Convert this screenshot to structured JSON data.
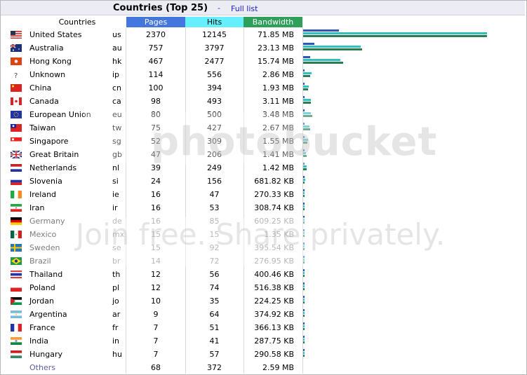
{
  "title": "Countries (Top 25)",
  "separator": "-",
  "full_list_link": "Full list",
  "headers": {
    "countries": "Countries",
    "pages": "Pages",
    "hits": "Hits",
    "bandwidth": "Bandwidth"
  },
  "colors": {
    "pages": "#4477dd",
    "hits": "#66f0ff",
    "bandwidth": "#2ea05a"
  },
  "rows": [
    {
      "flag": "us-flag-icon",
      "name": "United States",
      "code": "us",
      "pages": "2370",
      "hits": "12145",
      "bandwidth": "71.85 MB"
    },
    {
      "flag": "au-flag-icon",
      "name": "Australia",
      "code": "au",
      "pages": "757",
      "hits": "3797",
      "bandwidth": "23.13 MB"
    },
    {
      "flag": "hk-flag-icon",
      "name": "Hong Kong",
      "code": "hk",
      "pages": "467",
      "hits": "2477",
      "bandwidth": "15.74 MB"
    },
    {
      "flag": "unknown-flag-icon",
      "name": "Unknown",
      "code": "ip",
      "pages": "114",
      "hits": "556",
      "bandwidth": "2.86 MB"
    },
    {
      "flag": "cn-flag-icon",
      "name": "China",
      "code": "cn",
      "pages": "100",
      "hits": "394",
      "bandwidth": "1.93 MB"
    },
    {
      "flag": "ca-flag-icon",
      "name": "Canada",
      "code": "ca",
      "pages": "98",
      "hits": "493",
      "bandwidth": "3.11 MB"
    },
    {
      "flag": "eu-flag-icon",
      "name": "European Union",
      "code": "eu",
      "pages": "80",
      "hits": "500",
      "bandwidth": "3.48 MB"
    },
    {
      "flag": "tw-flag-icon",
      "name": "Taiwan",
      "code": "tw",
      "pages": "75",
      "hits": "427",
      "bandwidth": "2.67 MB"
    },
    {
      "flag": "sg-flag-icon",
      "name": "Singapore",
      "code": "sg",
      "pages": "52",
      "hits": "309",
      "bandwidth": "1.55 MB"
    },
    {
      "flag": "gb-flag-icon",
      "name": "Great Britain",
      "code": "gb",
      "pages": "47",
      "hits": "206",
      "bandwidth": "1.41 MB"
    },
    {
      "flag": "nl-flag-icon",
      "name": "Netherlands",
      "code": "nl",
      "pages": "39",
      "hits": "249",
      "bandwidth": "1.42 MB"
    },
    {
      "flag": "si-flag-icon",
      "name": "Slovenia",
      "code": "si",
      "pages": "24",
      "hits": "156",
      "bandwidth": "681.82 KB"
    },
    {
      "flag": "ie-flag-icon",
      "name": "Ireland",
      "code": "ie",
      "pages": "16",
      "hits": "47",
      "bandwidth": "270.33 KB"
    },
    {
      "flag": "ir-flag-icon",
      "name": "Iran",
      "code": "ir",
      "pages": "16",
      "hits": "53",
      "bandwidth": "308.74 KB"
    },
    {
      "flag": "de-flag-icon",
      "name": "Germany",
      "code": "de",
      "pages": "16",
      "hits": "85",
      "bandwidth": "609.25 KB"
    },
    {
      "flag": "mx-flag-icon",
      "name": "Mexico",
      "code": "mx",
      "pages": "15",
      "hits": "15",
      "bandwidth": "1.35 KB"
    },
    {
      "flag": "se-flag-icon",
      "name": "Sweden",
      "code": "se",
      "pages": "15",
      "hits": "92",
      "bandwidth": "395.54 KB"
    },
    {
      "flag": "br-flag-icon",
      "name": "Brazil",
      "code": "br",
      "pages": "14",
      "hits": "72",
      "bandwidth": "276.95 KB"
    },
    {
      "flag": "th-flag-icon",
      "name": "Thailand",
      "code": "th",
      "pages": "12",
      "hits": "56",
      "bandwidth": "400.46 KB"
    },
    {
      "flag": "pl-flag-icon",
      "name": "Poland",
      "code": "pl",
      "pages": "12",
      "hits": "74",
      "bandwidth": "516.38 KB"
    },
    {
      "flag": "jo-flag-icon",
      "name": "Jordan",
      "code": "jo",
      "pages": "10",
      "hits": "35",
      "bandwidth": "224.25 KB"
    },
    {
      "flag": "ar-flag-icon",
      "name": "Argentina",
      "code": "ar",
      "pages": "9",
      "hits": "64",
      "bandwidth": "374.92 KB"
    },
    {
      "flag": "fr-flag-icon",
      "name": "France",
      "code": "fr",
      "pages": "7",
      "hits": "51",
      "bandwidth": "366.13 KB"
    },
    {
      "flag": "in-flag-icon",
      "name": "India",
      "code": "in",
      "pages": "7",
      "hits": "41",
      "bandwidth": "287.75 KB"
    },
    {
      "flag": "hu-flag-icon",
      "name": "Hungary",
      "code": "hu",
      "pages": "7",
      "hits": "57",
      "bandwidth": "290.58 KB"
    }
  ],
  "others": {
    "name": "Others",
    "pages": "68",
    "hits": "372",
    "bandwidth": "2.59 MB"
  },
  "watermark": [
    "photobucket",
    "Join free. Share privately."
  ]
}
